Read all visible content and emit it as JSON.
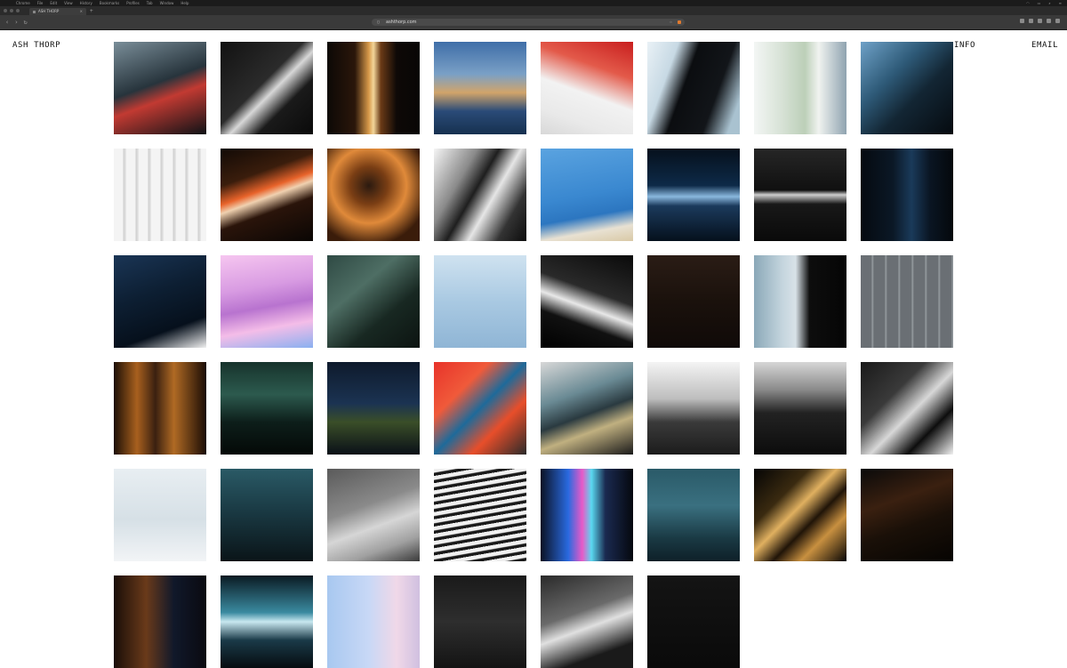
{
  "browser": {
    "tab_title": "ASH THORP",
    "tab_close": "×",
    "new_tab": "+",
    "url": "ashthorp.com",
    "menu_items": [
      "Chrome",
      "File",
      "Edit",
      "View",
      "History",
      "Bookmarks",
      "Profiles",
      "Tab",
      "Window",
      "Help"
    ]
  },
  "site": {
    "title": "ASH THORP",
    "nav": {
      "info": "INFO",
      "email": "EMAIL"
    }
  },
  "gallery": {
    "tiles": [
      {
        "bg": "linear-gradient(160deg,#7a8e99 0%,#27343c 45%,#c23a32 60%,#0e1216 100%)"
      },
      {
        "bg": "linear-gradient(135deg,#121212 0%,#2b2b2b 45%,#d8d8d8 55%,#1a1a1a 70%,#0a0a0a 100%)"
      },
      {
        "bg": "linear-gradient(90deg,#0d0906 0%,#2a160a 30%,#d89a4a 45%,#f3d69a 50%,#6a3a16 58%,#0e0907 75%,#080605 100%)"
      },
      {
        "bg": "linear-gradient(180deg,#3f6ea8 0%,#7aa0c6 35%,#d1a46a 55%,#2a4b78 75%,#16304f 100%)"
      },
      {
        "bg": "linear-gradient(200deg,#c81e1e 0%,#e35a4a 30%,#f2f2f2 55%,#e9e9e9 80%,#d8d8d8 100%)"
      },
      {
        "bg": "linear-gradient(110deg,#e9f1f6 0%,#c7d9e4 25%,#0b0d10 42%,#121519 70%,#a9c2d0 90%)"
      },
      {
        "bg": "linear-gradient(90deg,#f3f6f4 0%,#d7e2d6 30%,#bccfb8 55%,#f0f3f0 70%,#8fa3b0 100%)"
      },
      {
        "bg": "linear-gradient(135deg,#6fa2c8 0%,#2e5a78 35%,#132634 60%,#050a0f 100%)"
      },
      {
        "bg": "repeating-linear-gradient(90deg,#f4f4f4 0px,#f4f4f4 10px,#cfcfcf 11px,#e8e8e8 14px)"
      },
      {
        "bg": "linear-gradient(160deg,#120a06 0%,#3a1d0c 30%,#e8632a 45%,#f0d1b0 52%,#2a140a 65%,#0a0604 100%)"
      },
      {
        "bg": "radial-gradient(circle at 45% 40%,#2b1a10 0%,#7a3e14 25%,#e08a3a 50%,#3a1c0a 80%)"
      },
      {
        "bg": "linear-gradient(120deg,#f5f5f5 0%,#8a8a8a 30%,#1e1e1e 45%,#e6e6e6 60%,#333333 80%,#0c0c0c 100%)"
      },
      {
        "bg": "linear-gradient(170deg,#5aa3e0 0%,#3a88d0 50%,#2c76c0 70%,#e8e1d2 85%,#d9c9a6 100%)"
      },
      {
        "bg": "linear-gradient(180deg,#06101c 0%,#0d2a48 40%,#8ab8de 52%,#1b3a5c 62%,#05101c 100%)"
      },
      {
        "bg": "linear-gradient(180deg,#262626 0%,#101010 45%,#cfcfcf 50%,#181818 60%,#0a0a0a 100%)"
      },
      {
        "bg": "linear-gradient(90deg,#050a10 0%,#0b1826 35%,#1a3a5a 55%,#0a1522 75%,#04080c 100%)"
      },
      {
        "bg": "linear-gradient(160deg,#1a3555 0%,#0d1f33 40%,#06101c 75%,#f0f0f0 100%)"
      },
      {
        "bg": "linear-gradient(170deg,#f6c6f0 0%,#d89be2 35%,#b873cf 55%,#f4bde8 75%,#8ab0f0 100%)"
      },
      {
        "bg": "linear-gradient(140deg,#2f4a44 0%,#4e6e64 35%,#182822 65%,#0c1411 100%)"
      },
      {
        "bg": "linear-gradient(180deg,#cfe2f0 0%,#a9c9e2 50%,#8fb5d5 100%)"
      },
      {
        "bg": "linear-gradient(200deg,#0a0a0a 0%,#2a2a2a 40%,#e8e8e8 55%,#111111 70%,#000000 100%)"
      },
      {
        "bg": "linear-gradient(180deg,#2a1c15 0%,#1a110c 50%,#100a08 100%)"
      },
      {
        "bg": "linear-gradient(90deg,#8aa8b8 0%,#c3d4dd 30%,#d8e2e8 45%,#0d0d0d 60%,#050505 100%)"
      },
      {
        "bg": "repeating-linear-gradient(90deg,#6a6f74 0px,#6a6f74 12px,#9aa0a5 13px,#6a6f74 15px)"
      },
      {
        "bg": "linear-gradient(90deg,#1c0f06 0%,#a8601e 25%,#3a2010 45%,#b06a24 65%,#1a0c05 100%)"
      },
      {
        "bg": "linear-gradient(180deg,#17332c 0%,#2c5a4e 35%,#0d1e1a 65%,#040907 100%)"
      },
      {
        "bg": "linear-gradient(180deg,#0e1a2c 0%,#1b3352 45%,#3a4e28 65%,#0a1018 100%)"
      },
      {
        "bg": "linear-gradient(135deg,#e8332a 0%,#f05a3a 30%,#1e6a9a 50%,#e84e2a 70%,#2a2a2a 100%)"
      },
      {
        "bg": "linear-gradient(160deg,#d8d8d8 0%,#6a8a94 35%,#2a3a40 55%,#c0b080 70%,#1a1a1a 100%)"
      },
      {
        "bg": "linear-gradient(180deg,#f4f4f4 0%,#bdbdbd 40%,#3a3a3a 65%,#1c1c1c 100%)"
      },
      {
        "bg": "linear-gradient(180deg,#d6d6d6 0%,#8a8a8a 30%,#222222 55%,#0c0c0c 100%)"
      },
      {
        "bg": "linear-gradient(135deg,#1a1a1a 0%,#3a3a3a 35%,#d8d8d8 55%,#0d0d0d 75%,#f2f2f2 100%)"
      },
      {
        "bg": "linear-gradient(180deg,#e8eef2 0%,#d6e0e6 55%,#f2f4f6 100%)"
      },
      {
        "bg": "linear-gradient(180deg,#2a5a66 0%,#1a3a44 45%,#0a1418 100%)"
      },
      {
        "bg": "linear-gradient(160deg,#5a5a5a 0%,#8a8a8a 40%,#d6d6d6 60%,#a0a0a0 80%,#3a3a3a 100%)"
      },
      {
        "bg": "repeating-linear-gradient(170deg,#f0f0f0 0px,#f0f0f0 4px,#1a1a1a 5px,#1a1a1a 8px)"
      },
      {
        "bg": "linear-gradient(90deg,#0a1224 0%,#2a6ae0 30%,#e85ac8 45%,#5ad8f0 55%,#1a2a50 70%,#05080f 100%)"
      },
      {
        "bg": "linear-gradient(180deg,#2a5a68 0%,#3a7080 40%,#1a3a44 75%,#0e2028 100%)"
      },
      {
        "bg": "linear-gradient(135deg,#050505 0%,#3a2a10 30%,#e0b060 45%,#201408 60%,#c89040 75%,#080604 100%)"
      },
      {
        "bg": "linear-gradient(160deg,#0a0a0a 0%,#3a2010 35%,#1a1008 60%,#060402 100%)"
      },
      {
        "bg": "linear-gradient(90deg,#1a0e08 0%,#6a3a1a 35%,#10182a 65%,#0a0a10 100%)"
      },
      {
        "bg": "linear-gradient(180deg,#0a1a22 0%,#3a8aa0 40%,#c8e8f0 50%,#1a3a48 70%,#060c10 100%)"
      },
      {
        "bg": "linear-gradient(90deg,#a8c8f0 0%,#c8d8f6 45%,#f0d8e8 75%,#d0c0e0 100%)"
      },
      {
        "bg": "linear-gradient(180deg,#1a1a1a 0%,#2e2e2e 50%,#141414 100%)"
      },
      {
        "bg": "linear-gradient(160deg,#2a2a2a 0%,#6a6a6a 40%,#e0e0e0 55%,#1a1a1a 80%)"
      },
      {
        "bg": "linear-gradient(180deg,#141414 0%,#0a0a0a 100%)"
      }
    ]
  }
}
